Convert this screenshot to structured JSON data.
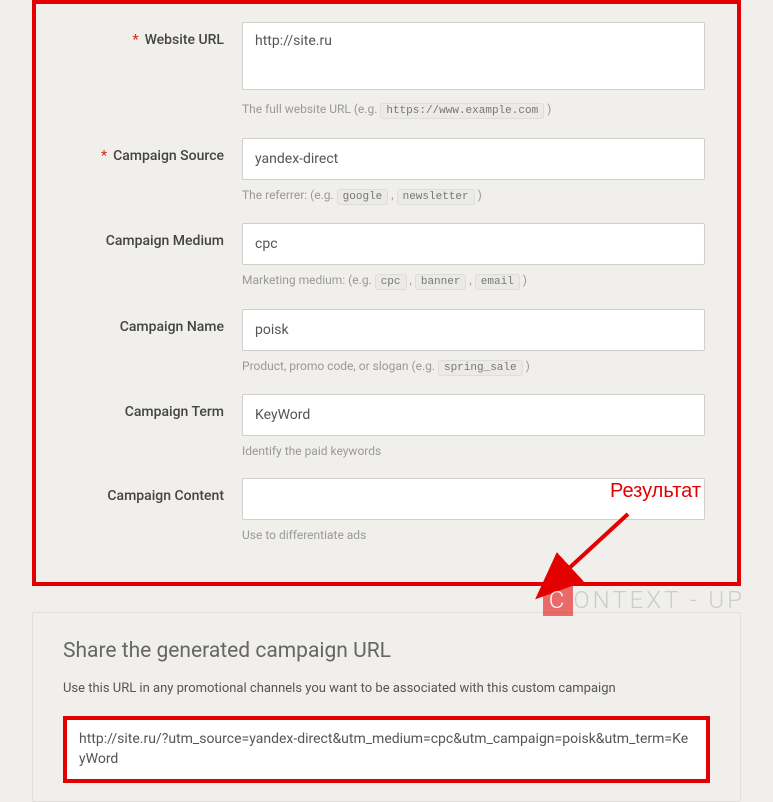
{
  "form": {
    "fields": [
      {
        "label": "Website URL",
        "required": true,
        "value": "http://site.ru",
        "type": "textarea",
        "helper_prefix": "The full website URL (e.g. ",
        "helper_codes": [
          "https://www.example.com"
        ],
        "helper_suffix": ")"
      },
      {
        "label": "Campaign Source",
        "required": true,
        "value": "yandex-direct",
        "type": "text",
        "helper_prefix": "The referrer: (e.g. ",
        "helper_codes": [
          "google",
          "newsletter"
        ],
        "helper_suffix": ")"
      },
      {
        "label": "Campaign Medium",
        "required": false,
        "value": "cpc",
        "type": "text",
        "helper_prefix": "Marketing medium: (e.g. ",
        "helper_codes": [
          "cpc",
          "banner",
          "email"
        ],
        "helper_suffix": ")"
      },
      {
        "label": "Campaign Name",
        "required": false,
        "value": "poisk",
        "type": "text",
        "helper_prefix": "Product, promo code, or slogan (e.g. ",
        "helper_codes": [
          "spring_sale"
        ],
        "helper_suffix": ")"
      },
      {
        "label": "Campaign Term",
        "required": false,
        "value": "KeyWord",
        "type": "text",
        "helper_prefix": "Identify the paid keywords",
        "helper_codes": [],
        "helper_suffix": ""
      },
      {
        "label": "Campaign Content",
        "required": false,
        "value": "",
        "type": "text",
        "helper_prefix": "Use to differentiate ads",
        "helper_codes": [],
        "helper_suffix": ""
      }
    ]
  },
  "result": {
    "title": "Share the generated campaign URL",
    "description": "Use this URL in any promotional channels you want to be associated with this custom campaign",
    "url": "http://site.ru/?utm_source=yandex-direct&utm_medium=cpc&utm_campaign=poisk&utm_term=KeyWord"
  },
  "annotation": "Результат",
  "watermark": {
    "accent": "C",
    "rest": "ONTEXT - UP"
  }
}
